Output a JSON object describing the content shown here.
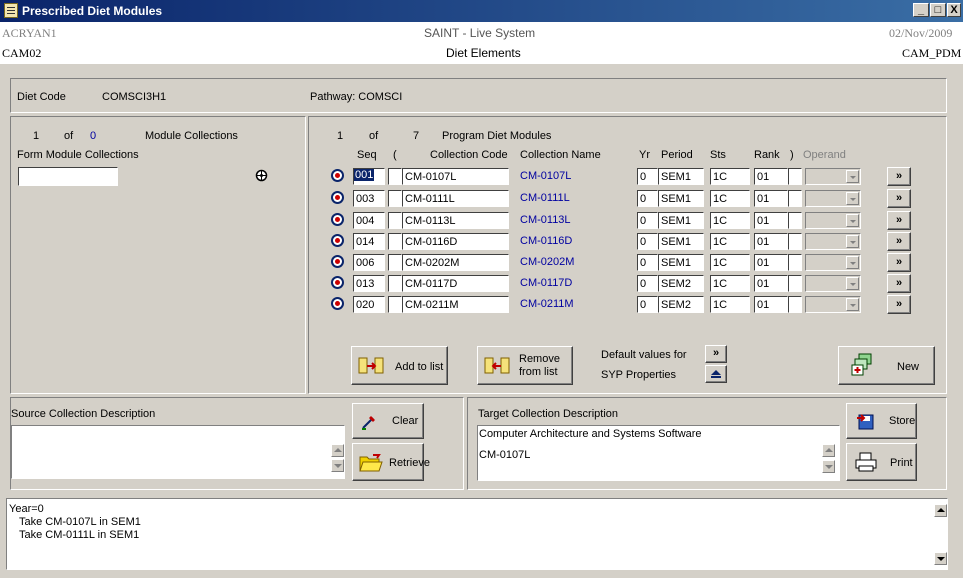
{
  "window": {
    "title": "Prescribed Diet Modules",
    "minimize": "_",
    "maximize": "□",
    "close": "X"
  },
  "header": {
    "user": "ACRYAN1",
    "system": "SAINT - Live System",
    "date": "02/Nov/2009",
    "module": "CAM02",
    "screen": "Diet Elements",
    "program": "CAM_PDM"
  },
  "diet": {
    "code_label": "Diet Code",
    "code": "COMSCI3H1",
    "pathway": "Pathway: COMSCI"
  },
  "left": {
    "counter_current": "1",
    "counter_of": "of",
    "counter_total": "0",
    "title": "Module Collections",
    "form_label": "Form Module Collections",
    "form_value": ""
  },
  "program": {
    "counter_current": "1",
    "counter_of": "of",
    "counter_total": "7",
    "title": "Program Diet Modules",
    "columns": {
      "seq": "Seq",
      "paren_open": "(",
      "collection_code": "Collection Code",
      "collection_name": "Collection Name",
      "yr": "Yr",
      "period": "Period",
      "sts": "Sts",
      "rank": "Rank",
      "paren_close": ")",
      "operand": "Operand"
    },
    "rows": [
      {
        "seq": "001",
        "code": "CM-0107L",
        "name": "CM-0107L",
        "yr": "0",
        "period": "SEM1",
        "sts": "1C",
        "rank": "01",
        "more": "»"
      },
      {
        "seq": "003",
        "code": "CM-0111L",
        "name": "CM-0111L",
        "yr": "0",
        "period": "SEM1",
        "sts": "1C",
        "rank": "01",
        "more": "»"
      },
      {
        "seq": "004",
        "code": "CM-0113L",
        "name": "CM-0113L",
        "yr": "0",
        "period": "SEM1",
        "sts": "1C",
        "rank": "01",
        "more": "»"
      },
      {
        "seq": "014",
        "code": "CM-0116D",
        "name": "CM-0116D",
        "yr": "0",
        "period": "SEM1",
        "sts": "1C",
        "rank": "01",
        "more": "»"
      },
      {
        "seq": "006",
        "code": "CM-0202M",
        "name": "CM-0202M",
        "yr": "0",
        "period": "SEM1",
        "sts": "1C",
        "rank": "01",
        "more": "»"
      },
      {
        "seq": "013",
        "code": "CM-0117D",
        "name": "CM-0117D",
        "yr": "0",
        "period": "SEM2",
        "sts": "1C",
        "rank": "01",
        "more": "»"
      },
      {
        "seq": "020",
        "code": "CM-0211M",
        "name": "CM-0211M",
        "yr": "0",
        "period": "SEM2",
        "sts": "1C",
        "rank": "01",
        "more": "»"
      }
    ]
  },
  "buttons": {
    "add_to_list": "Add to list",
    "remove_line1": "Remove",
    "remove_line2": "from list",
    "default_line1": "Default values for",
    "default_line2": "SYP Properties",
    "default_more": "»",
    "new": "New",
    "clear": "Clear",
    "retrieve": "Retrieve",
    "store": "Store",
    "print": "Print"
  },
  "source": {
    "label": "Source Collection Description",
    "text": ""
  },
  "target": {
    "label": "Target Collection Description",
    "line1": "Computer Architecture and Systems Software",
    "line2": "CM-0107L"
  },
  "log": {
    "line1": "Year=0",
    "line2": "Take CM-0107L in SEM1",
    "line3": "Take CM-0111L in SEM1"
  }
}
